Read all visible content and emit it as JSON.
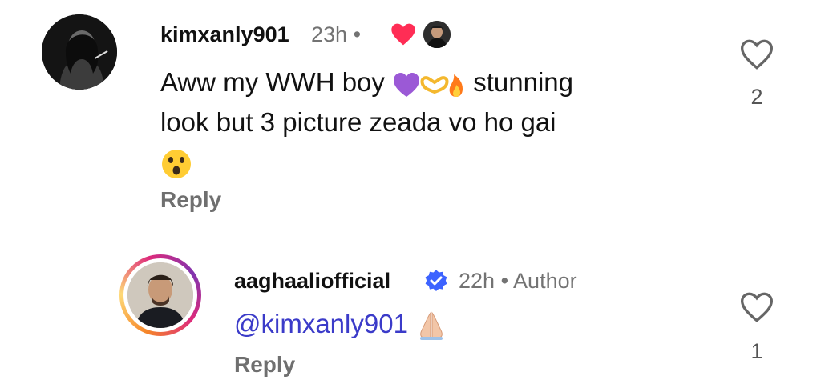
{
  "comments": [
    {
      "username": "kimxanly901",
      "time": "23h",
      "separator": "•",
      "text_line1": "Aww my WWH boy",
      "text_line1_end": "stunning",
      "text_line2": "look but 3 picture zeada vo ho gai",
      "reply_label": "Reply",
      "like_count": "2"
    },
    {
      "username": "aaghaaliofficial",
      "time": "22h",
      "separator": "•",
      "author_label": "Author",
      "mention": "@kimxanly901",
      "reply_label": "Reply",
      "like_count": "1"
    }
  ],
  "icons": {
    "liked_by_author": "red-heart-icon",
    "verified": "verified-badge-icon",
    "like": "heart-outline-icon"
  },
  "colors": {
    "mention": "#3b3bc9",
    "liked_heart": "#ff2d55",
    "verified": "#3d63ff",
    "muted": "#737373"
  }
}
